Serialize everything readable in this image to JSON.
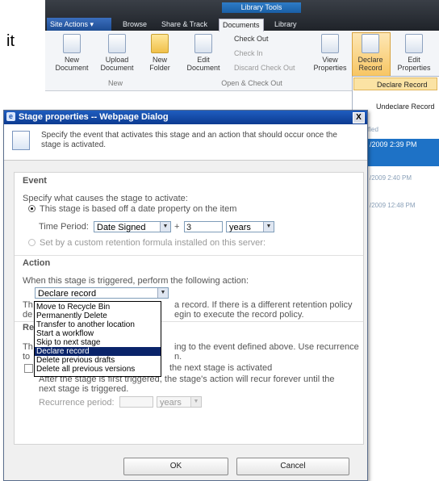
{
  "background": {
    "doc_fragment": "it",
    "ribbon": {
      "context_tab": "Library Tools",
      "site_actions": "Site Actions",
      "tabs": [
        "Browse",
        "Share & Track",
        "Documents",
        "Library"
      ],
      "active_tab": "Documents",
      "buttons": {
        "new_document": "New Document",
        "upload_document": "Upload Document",
        "new_folder": "New Folder",
        "edit_document": "Edit Document",
        "check_out": "Check Out",
        "check_in": "Check In",
        "discard_check_out": "Discard Check Out",
        "view_properties": "View Properties",
        "declare_record": "Declare Record",
        "edit_properties": "Edit Properties"
      },
      "groups": {
        "new": "New",
        "open_check_out": "Open & Check Out"
      }
    },
    "declare_menu": {
      "declare": "Declare Record",
      "undeclare": "Undeclare Record"
    },
    "list": {
      "column_header": "fied",
      "rows": [
        "/2009 2:39 PM",
        "/2009 2:40 PM",
        "/2009 12:48 PM"
      ]
    }
  },
  "dialog": {
    "title": "Stage properties -- Webpage Dialog",
    "close": "X",
    "header_text": "Specify the event that activates this stage and an action that should occur once the stage is activated.",
    "event": {
      "heading": "Event",
      "instruction": "Specify what causes the stage to activate:",
      "option_date": "This stage is based off a date property on the item",
      "time_period_label": "Time Period:",
      "date_field": "Date Signed",
      "plus": "+",
      "amount": "3",
      "unit": "years",
      "option_custom": "Set by a custom retention formula installed on this server:"
    },
    "action": {
      "heading": "Action",
      "instruction": "When this stage is triggered, perform the following action:",
      "selected": "Declare record",
      "desc_prefix1": "Th",
      "desc_suffix1": "a record. If there is a different retention policy",
      "desc_prefix2": "de",
      "desc_suffix2": "egin to execute the record policy.",
      "options": [
        "Move to Recycle Bin",
        "Permanently Delete",
        "Transfer to another location",
        "Start a workflow",
        "Skip to next stage",
        "Declare record",
        "Delete previous drafts",
        "Delete all previous versions"
      ],
      "selected_option_index": 5
    },
    "recurrence": {
      "heading_prefix": "Re",
      "desc_prefix": "Th",
      "desc_suffix": "ing to the event defined above. Use recurrence",
      "desc2_prefix": "to",
      "desc2_suffix": "n.",
      "checkbox_suffix": "the next stage is activated",
      "note": "After the stage is first triggered, the stage's action will recur forever until the next stage is triggered.",
      "period_label": "Recurrence period:",
      "period_value": "",
      "period_unit": "years"
    },
    "ok": "OK",
    "cancel": "Cancel"
  }
}
